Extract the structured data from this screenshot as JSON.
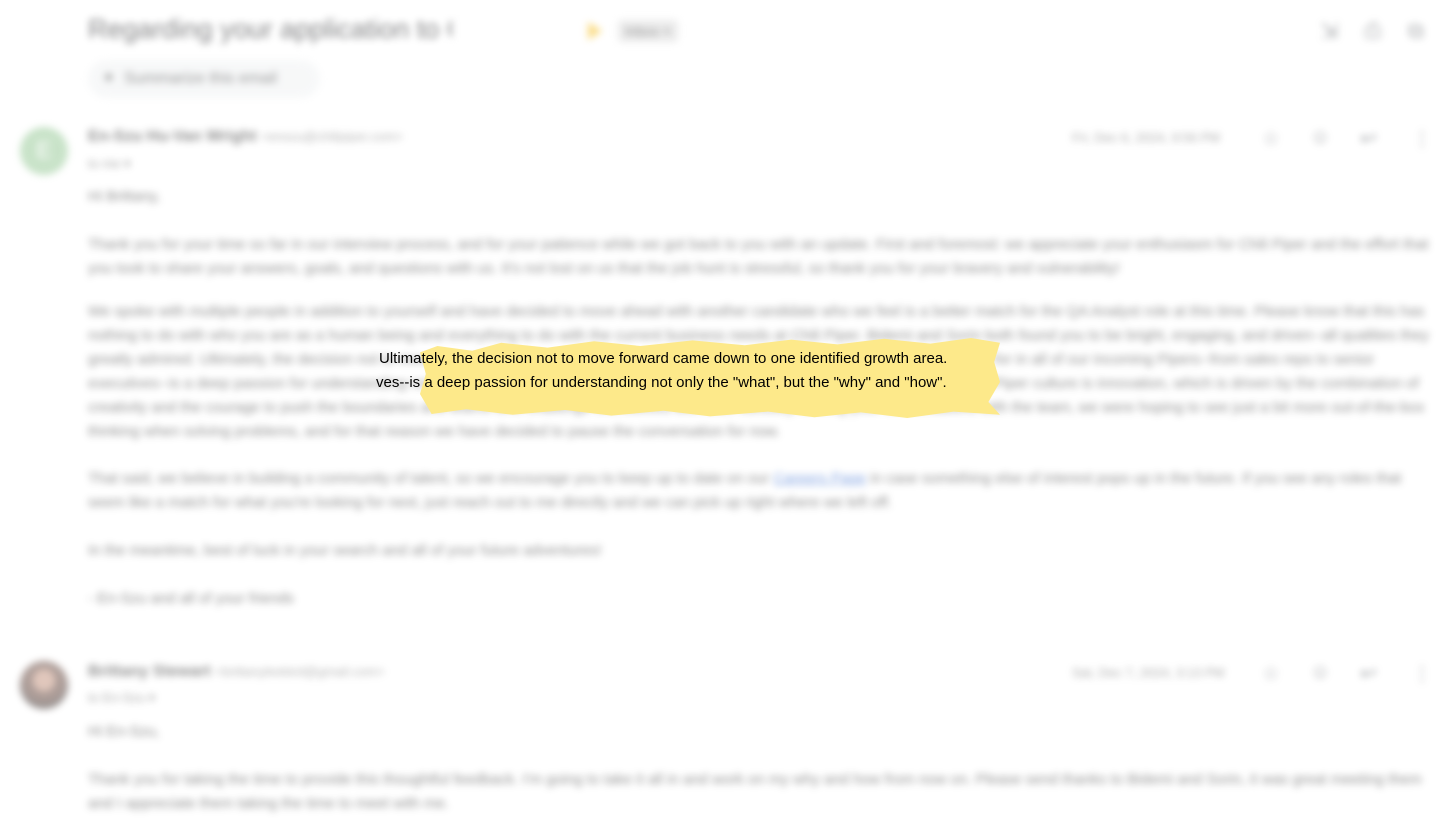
{
  "thread": {
    "subject": "Regarding your application to Chili Piper",
    "label": "Inbox ×",
    "summarize_label": "Summarize this email",
    "icons": [
      "collapse-icon",
      "print-icon",
      "open-in-new-icon"
    ]
  },
  "messages": [
    {
      "avatar_letter": "E",
      "sender_name": "En-Szu Hu-Van Wright",
      "sender_email": "<enszu@chilipiper.com>",
      "recipient": "to me ▾",
      "date": "Fri, Dec 6, 2024, 9:56 PM",
      "greeting": "Hi Brittany,",
      "p1": "Thank you for your time so far in our interview process, and for your patience while we got back to you with an update. First and foremost: we appreciate your enthusiasm for Chili Piper and the effort that you took to share your answers, goals, and questions with us. It's not lost on us that the job hunt is stressful, so thank you for your bravery and vulnerability!",
      "p2": "We spoke with multiple people in addition to yourself and have decided to move ahead with another candidate who we feel is a better match for the QA Analyst role at this time. Please know that this has nothing to do with who you are as a human being and everything to do with the current business needs at Chili Piper. Bidemi and Sorin both found you to be bright, engaging, and driven--all qualities they greatly admired. Ultimately, the decision not to move forward came down to one identified growth area. One of the core qualities we look for in all of our incoming Pipers--from sales reps to senior executives--is a deep passion for understanding not only the \"what\", but the \"why\" and \"how\". We do this because a central pillar of Chili Piper culture is innovation, which is driven by the combination of creativity and the courage to push the boundaries and teams who challenge themselves with their curiosity! During your conversations with the team, we were hoping to see just a bit more out-of-the-box thinking when solving problems, and for that reason we have decided to pause the conversation for now.",
      "p3_before": "That said, we believe in building a community of talent, so we encourage you to keep up to date on our ",
      "p3_link": "Careers Page",
      "p3_after": " in case something else of interest pops up in the future. If you see any roles that seem like a match for what you're looking for next, just reach out to me directly and we can pick up right where we left off.",
      "p4": "In the meantime, best of luck in your search and all of your future adventures!",
      "signoff": "- En-Szu and all of your friends"
    },
    {
      "sender_name": "Brittany Stewart",
      "sender_email": "<brittanyleebird@gmail.com>",
      "recipient": "to En-Szu ▾",
      "date": "Sat, Dec 7, 2024, 3:13 PM",
      "greeting": "Hi En-Szu,",
      "p1": "Thank you for taking the time to provide this thoughtful feedback. I'm going to take it all in and work on my why and how from now on. Please send thanks to Bidemi and Sorin, it was great meeting them and I appreciate them taking the time to meet with me."
    }
  ],
  "highlight": {
    "line1": "Ultimately, the decision not to move forward came down to one identified growth area.",
    "line2": "ves--is a deep passion for understanding not only the \"what\", but the \"why\" and \"how\".",
    "color": "#fde98a"
  },
  "colors": {
    "link": "#1a56c9",
    "important": "#f6c026"
  }
}
